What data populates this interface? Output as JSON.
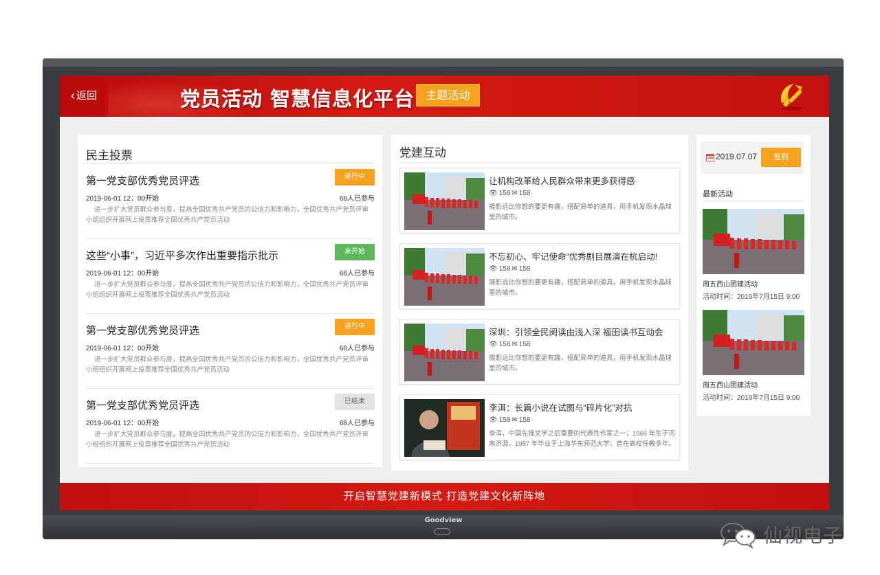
{
  "device": {
    "brand": "Goodview"
  },
  "header": {
    "back_label": "返回",
    "title": "党员活动  智慧信息化平台",
    "theme_button": "主题活动"
  },
  "vote": {
    "title": "民主投票",
    "items": [
      {
        "title": "第一党支部优秀党员评选",
        "status": "进行中",
        "time": "2019-06-01 12：00开始",
        "count": "68人已参与",
        "desc": "进一步扩大党员群众参与度，提高全国优秀共产党员的公信力和影响力，全国优秀共产党员评审小组组织开展网上投票推荐全国优秀共产党员活动"
      },
      {
        "title": "这些“小事”，习近平多次作出重要指示批示",
        "status": "未开始",
        "time": "2019-06-01 12：00开始",
        "count": "68人已参与",
        "desc": "进一步扩大党员群众参与度，提高全国优秀共产党员的公信力和影响力，全国优秀共产党员评审小组组织开展网上投票推荐全国优秀共产党员活动"
      },
      {
        "title": "第一党支部优秀党员评选",
        "status": "进行中",
        "time": "2019-06-01 12：00开始",
        "count": "68人已参与",
        "desc": "进一步扩大党员群众参与度，提高全国优秀共产党员的公信力和影响力，全国优秀共产党员评审小组组织开展网上投票推荐全国优秀共产党员活动"
      },
      {
        "title": "第一党支部优秀党员评选",
        "status": "已结束",
        "time": "2019-06-01 12：00开始",
        "count": "68人已参与",
        "desc": "进一步扩大党员群众参与度，提高全国优秀共产党员的公信力和影响力，全国优秀共产党员评审小组组织开展网上投票推荐全国优秀共产党员活动"
      }
    ]
  },
  "interaction": {
    "title": "党建互动",
    "items": [
      {
        "title": "让机构改革给人民群众带来更多获得感",
        "views": "158",
        "comments": "158",
        "desc": "摄影远比你想的要更有趣，搭配简单的道具，用手机发现水晶球里的城市。"
      },
      {
        "title": "不忘初心、牢记使命”优秀剧目展演在杭启动!",
        "views": "158",
        "comments": "158",
        "desc": "摄影远比你想的要更有趣，搭配简单的道具，用手机发现水晶球里的城市。"
      },
      {
        "title": "深圳：引领全民阅读由浅入深 福田读书互动会",
        "views": "158",
        "comments": "158",
        "desc": "摄影远比你想的要更有趣，搭配简单的道具，用手机发现水晶球里的城市。"
      },
      {
        "title": "李洱：长篇小说在试图与“碎片化”对抗",
        "views": "158",
        "comments": "158",
        "desc": "李洱，中国先锋文学之后重要的代表性作家之一；1966 年生于河南济源，1987 年毕业于上海华东师范大学；曾在高校任教多年。"
      }
    ]
  },
  "side": {
    "date": "2019.07.07",
    "sign_button": "签到",
    "latest_title": "最新活动",
    "activities": [
      {
        "name": "周五西山团建活动",
        "time": "活动时间：2019年7月15日 9:00"
      },
      {
        "name": "周五西山团建活动",
        "time": "活动时间：2019年7月15日 9:00"
      }
    ]
  },
  "footer": {
    "slogan": "开启智慧党建新模式    打造党建文化新阵地"
  },
  "watermark": {
    "text": "仙视电子"
  },
  "colors": {
    "header_red": "#c4110e",
    "accent_orange": "#f6a21c",
    "status_green": "#5cb85c",
    "status_gray": "#e3e3e3"
  },
  "icons": [
    "chevron-left-icon",
    "party-emblem-icon",
    "eye-icon",
    "comment-icon",
    "calendar-icon",
    "wechat-icon"
  ]
}
